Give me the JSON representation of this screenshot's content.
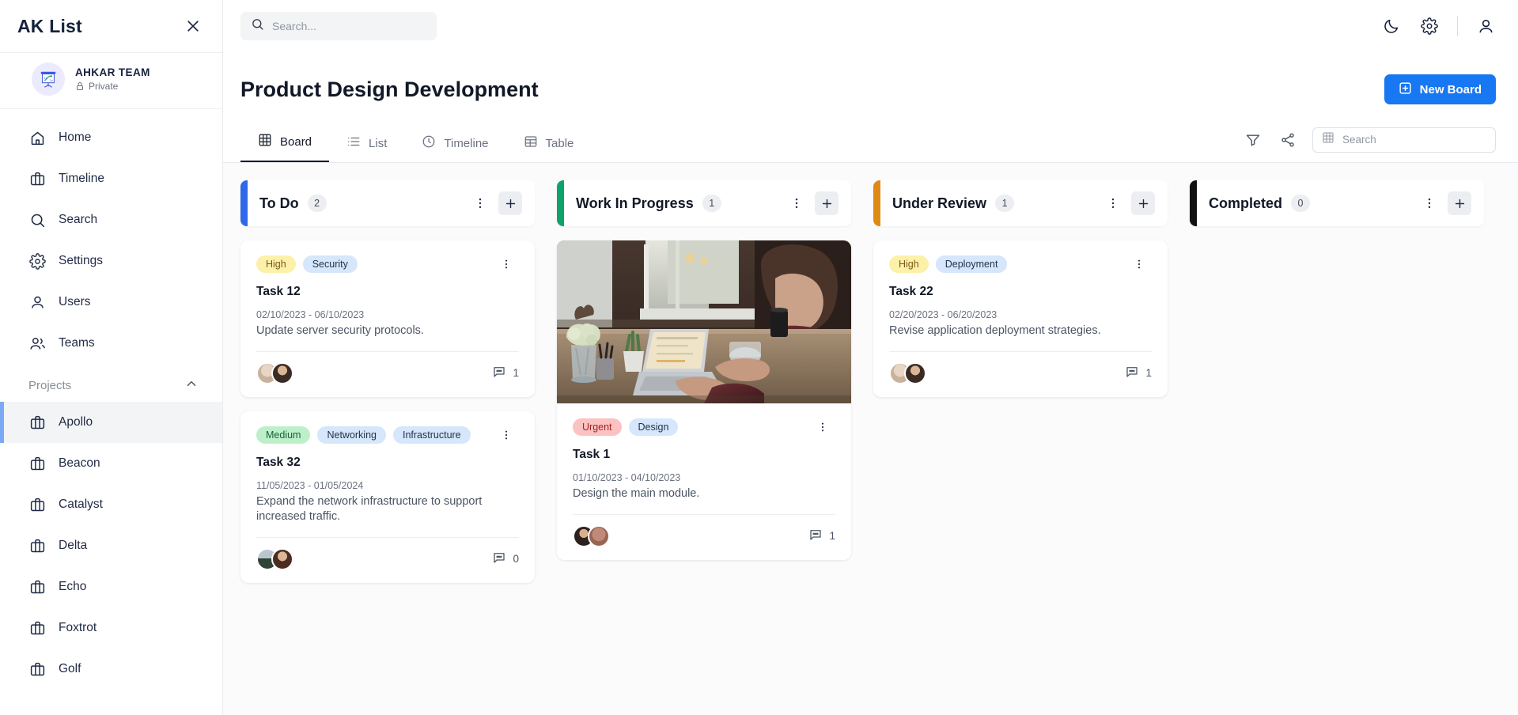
{
  "sidebar": {
    "logo": "AK List",
    "close_icon": "close-icon",
    "team": {
      "name": "AHKAR TEAM",
      "visibility": "Private",
      "lock_icon": "lock-icon"
    },
    "items": [
      {
        "label": "Home",
        "icon": "home-icon",
        "active": false
      },
      {
        "label": "Timeline",
        "icon": "briefcase-icon",
        "active": false
      },
      {
        "label": "Search",
        "icon": "search-icon",
        "active": false
      },
      {
        "label": "Settings",
        "icon": "gear-icon",
        "active": false
      },
      {
        "label": "Users",
        "icon": "user-icon",
        "active": false
      },
      {
        "label": "Teams",
        "icon": "users-icon",
        "active": false
      }
    ],
    "projects_section": {
      "label": "Projects",
      "chevron_icon": "chevron-up-icon"
    },
    "projects": [
      {
        "label": "Apollo",
        "icon": "briefcase-icon",
        "active": true
      },
      {
        "label": "Beacon",
        "icon": "briefcase-icon",
        "active": false
      },
      {
        "label": "Catalyst",
        "icon": "briefcase-icon",
        "active": false
      },
      {
        "label": "Delta",
        "icon": "briefcase-icon",
        "active": false
      },
      {
        "label": "Echo",
        "icon": "briefcase-icon",
        "active": false
      },
      {
        "label": "Foxtrot",
        "icon": "briefcase-icon",
        "active": false
      },
      {
        "label": "Golf",
        "icon": "briefcase-icon",
        "active": false
      }
    ]
  },
  "topbar": {
    "search_placeholder": "Search...",
    "search_value": "",
    "search_icon": "search-icon",
    "moon_icon": "moon-icon",
    "gear_icon": "gear-icon",
    "account_icon": "user-icon"
  },
  "header": {
    "title": "Product Design Development",
    "new_board_label": "New Board",
    "new_board_icon": "plus-square-icon"
  },
  "tabs": [
    {
      "label": "Board",
      "icon": "grid-icon",
      "active": true
    },
    {
      "label": "List",
      "icon": "list-icon",
      "active": false
    },
    {
      "label": "Timeline",
      "icon": "clock-icon",
      "active": false
    },
    {
      "label": "Table",
      "icon": "table-icon",
      "active": false
    }
  ],
  "tab_tools": {
    "filter_icon": "filter-icon",
    "share_icon": "share-icon",
    "search_placeholder": "Search",
    "search_value": "",
    "search_icon": "grid-icon"
  },
  "colors": {
    "todo": "#2f68e8",
    "in_progress": "#0ea36a",
    "under_review": "#e08a16",
    "completed": "#111111",
    "accent": "#1877f2"
  },
  "columns": [
    {
      "title": "To Do",
      "count": "2",
      "accent": "#2f68e8",
      "menu_icon": "dots-vertical-icon",
      "add_icon": "plus-icon",
      "cards": [
        {
          "tags": [
            {
              "label": "High",
              "style": "high"
            },
            {
              "label": "Security",
              "style": "plain"
            }
          ],
          "title": "Task 12",
          "dates": "02/10/2023 - 06/10/2023",
          "description": "Update server security protocols.",
          "comments": "1",
          "image": false,
          "avatars": [
            "#d7c3ae",
            "#4a3a34"
          ]
        },
        {
          "tags": [
            {
              "label": "Medium",
              "style": "medium"
            },
            {
              "label": "Networking",
              "style": "plain"
            },
            {
              "label": "Infrastructure",
              "style": "plain"
            }
          ],
          "title": "Task 32",
          "dates": "11/05/2023 - 01/05/2024",
          "description": "Expand the network infrastructure to support increased traffic.",
          "comments": "0",
          "image": false,
          "avatars": [
            "#9aaab4",
            "#5a3a2e"
          ]
        }
      ]
    },
    {
      "title": "Work In Progress",
      "count": "1",
      "accent": "#0ea36a",
      "menu_icon": "dots-vertical-icon",
      "add_icon": "plus-icon",
      "cards": [
        {
          "tags": [
            {
              "label": "Urgent",
              "style": "urgent"
            },
            {
              "label": "Design",
              "style": "plain"
            }
          ],
          "title": "Task 1",
          "dates": "01/10/2023 - 04/10/2023",
          "description": "Design the main module.",
          "comments": "1",
          "image": true,
          "image_alt": "person working on laptop at a wooden desk",
          "avatars": [
            "#3a2a26",
            "#c08878"
          ]
        }
      ]
    },
    {
      "title": "Under Review",
      "count": "1",
      "accent": "#e08a16",
      "menu_icon": "dots-vertical-icon",
      "add_icon": "plus-icon",
      "cards": [
        {
          "tags": [
            {
              "label": "High",
              "style": "high"
            },
            {
              "label": "Deployment",
              "style": "plain"
            }
          ],
          "title": "Task 22",
          "dates": "02/20/2023 - 06/20/2023",
          "description": "Revise application deployment strategies.",
          "comments": "1",
          "image": false,
          "avatars": [
            "#d7c3ae",
            "#4a3a34"
          ]
        }
      ]
    },
    {
      "title": "Completed",
      "count": "0",
      "accent": "#111111",
      "menu_icon": "dots-vertical-icon",
      "add_icon": "plus-icon",
      "cards": []
    }
  ]
}
